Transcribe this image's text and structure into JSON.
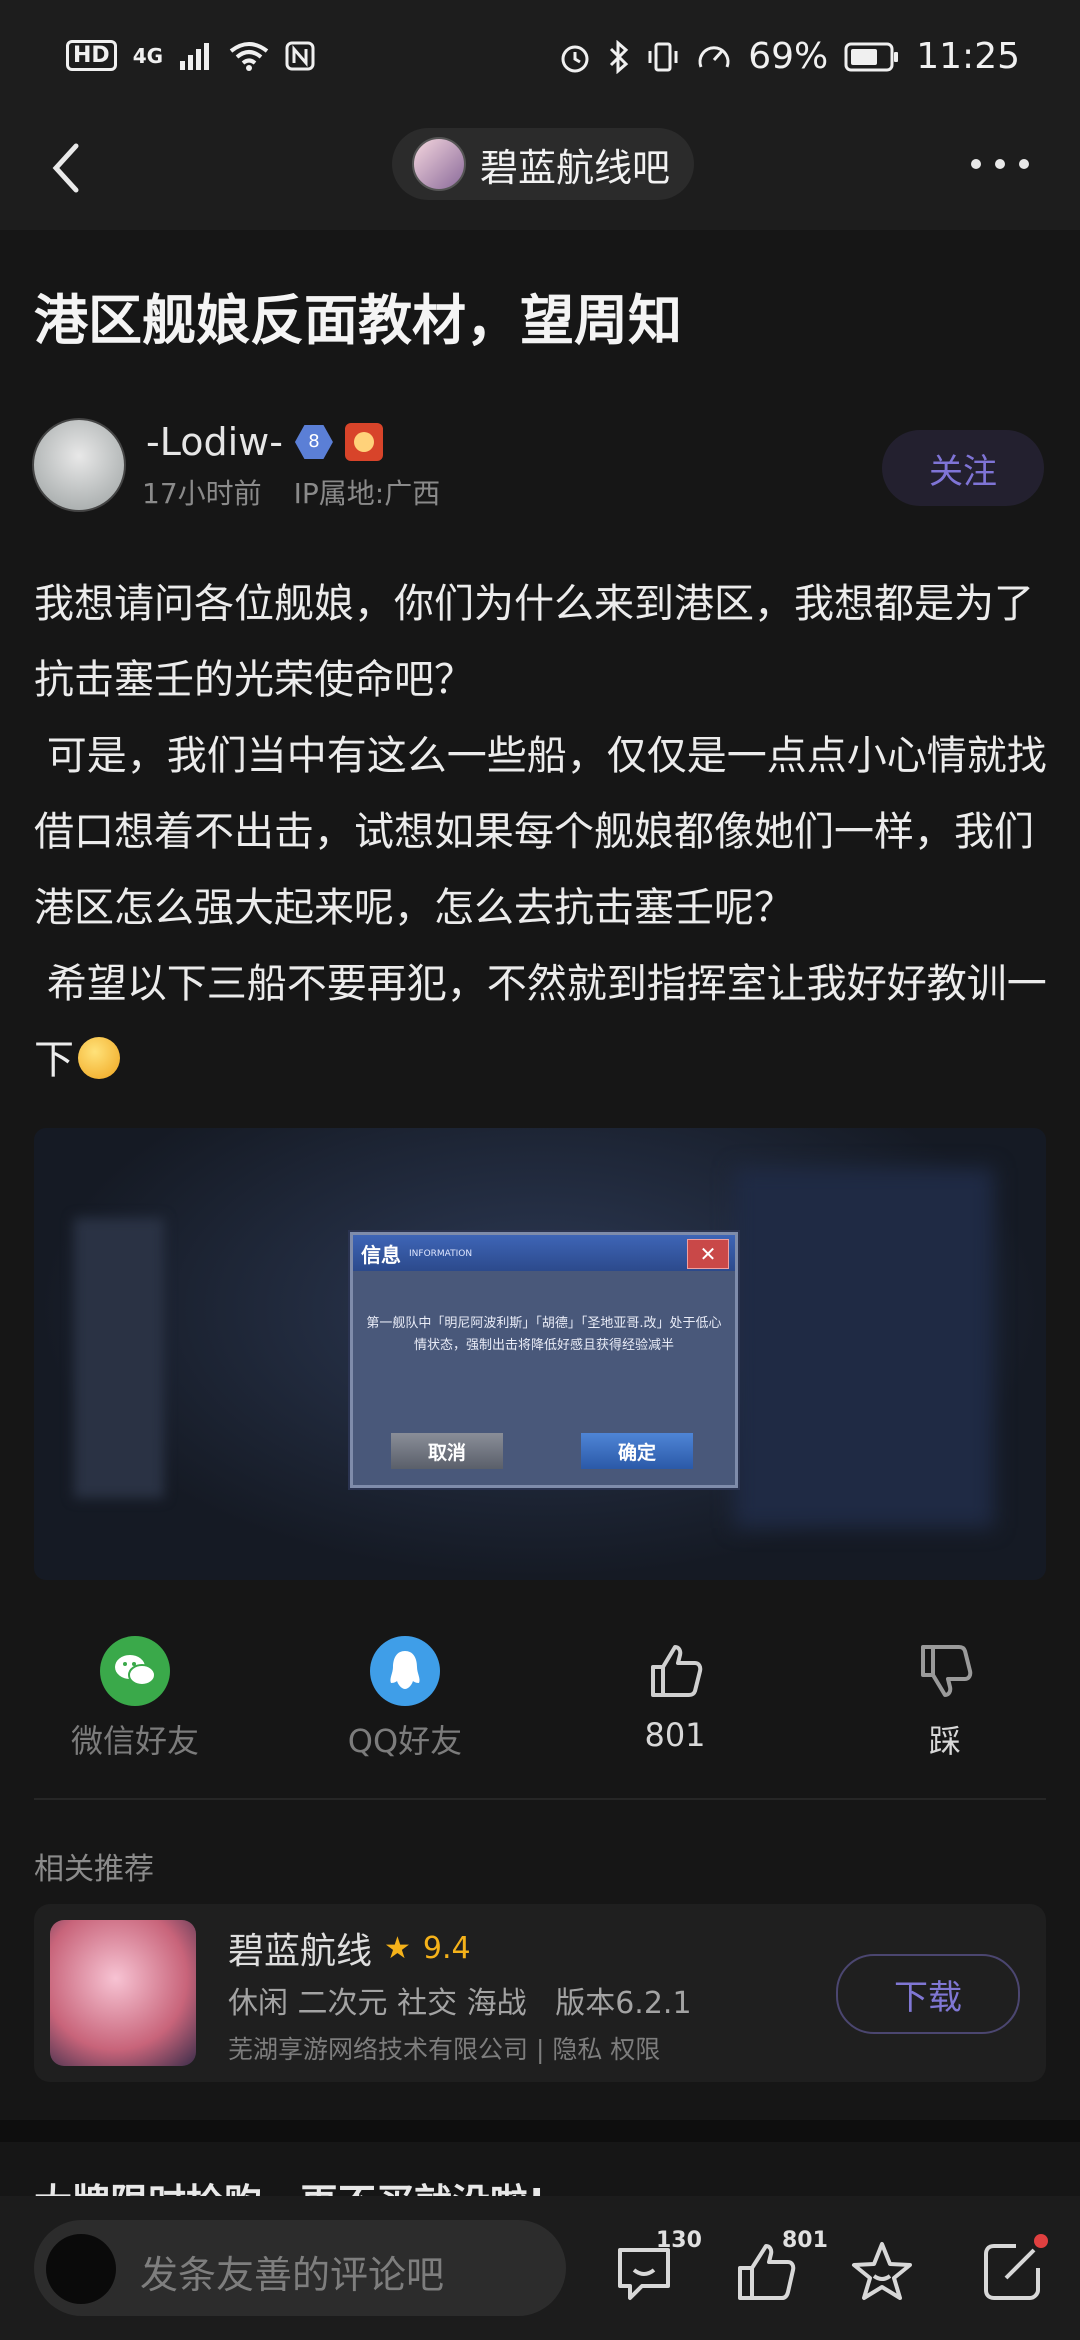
{
  "status_bar": {
    "left_indicators": [
      "HD",
      "4G",
      "signal-icon",
      "wifi-icon",
      "nfc-icon"
    ],
    "battery": "69%",
    "time": "11:25"
  },
  "header": {
    "forum_name": "碧蓝航线吧",
    "back_icon": "chevron-left-icon",
    "more_icon": "more-horizontal-icon"
  },
  "post": {
    "title": "港区舰娘反面教材，望周知",
    "author": {
      "name": "-Lodiw-",
      "level": "8",
      "time_ago": "17小时前",
      "ip_location": "IP属地:广西"
    },
    "follow_label": "关注",
    "body": "我想请问各位舰娘，你们为什么来到港区，我想都是为了抗击塞壬的光荣使命吧？\n 可是，我们当中有这么一些船，仅仅是一点点小心情就找借口想着不出击，试想如果每个舰娘都像她们一样，我们港区怎么强大起来呢，怎么去抗击塞壬呢？\n 希望以下三船不要再犯，不然就到指挥室让我好好教训一下",
    "image": {
      "dialog_title": "信息",
      "dialog_subtitle": "INFORMATION",
      "dialog_message": "第一舰队中「明尼阿波利斯」「胡德」「圣地亚哥.改」处于低心情状态，强制出击将降低好感且获得经验减半",
      "cancel_label": "取消",
      "ok_label": "确定"
    }
  },
  "share_row": {
    "wechat_label": "微信好友",
    "qq_label": "QQ好友",
    "like_count": "801",
    "dislike_label": "踩"
  },
  "recommend": {
    "section_label": "相关推荐",
    "app_name": "碧蓝航线",
    "rating": "9.4",
    "tags": "休闲 二次元 社交 海战   版本6.2.1",
    "developer": "芜湖享游网络技术有限公司 | 隐私 权限",
    "download_label": "下载"
  },
  "promo_text": "大牌限时抢购，再不买就没啦!",
  "bottom_bar": {
    "comment_placeholder": "发条友善的评论吧",
    "comment_count": "130",
    "like_count": "801"
  },
  "colors": {
    "background": "#161616",
    "accent": "#7f74d6",
    "rating": "#f5b21a",
    "wechat": "#3aa94a",
    "qq": "#3f9ee8"
  }
}
